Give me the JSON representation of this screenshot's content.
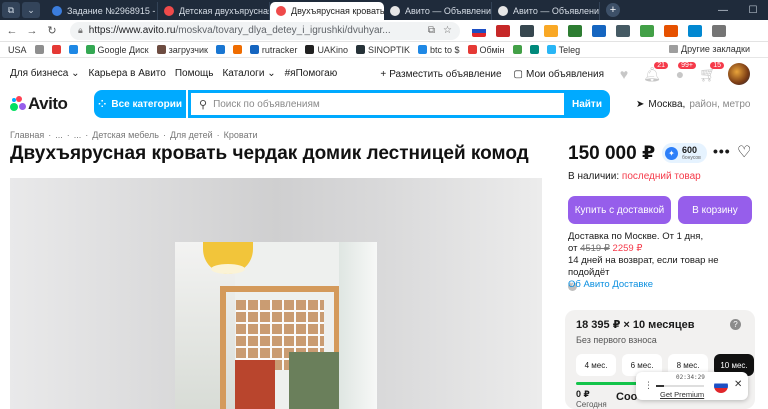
{
  "browser": {
    "tabs": [
      {
        "title": "Задание №2968915 - прос",
        "color": "#3b7ddd",
        "active": false
      },
      {
        "title": "Детская двухъярусная кр",
        "color": "#ef4a4a",
        "active": false
      },
      {
        "title": "Двухъярусная кровать",
        "color": "#ef4a4a",
        "active": true
      },
      {
        "title": "Авито — Объявления на",
        "color": "#2a2a2a",
        "active": false
      },
      {
        "title": "Авито — Объявления на",
        "color": "#2a2a2a",
        "active": false
      }
    ],
    "url_domain": "https://www.avito.ru",
    "url_path": "/moskva/tovary_dlya_detey_i_igrushki/dvuhyar...",
    "bookmarks": [
      "USA",
      "",
      "",
      "",
      "Google Диск",
      "загрузчик",
      "",
      "",
      "rutracker",
      "UAKino",
      "SINOPTIK",
      "btc to $",
      "Обмін",
      "",
      "",
      "",
      "Teleg"
    ],
    "bookmarks_other": "Другие закладки"
  },
  "topnav": {
    "links": [
      "Для бизнеса",
      "Карьера в Авито",
      "Помощь",
      "Каталоги",
      "#яПомогаю"
    ],
    "post_ad": "Разместить объявление",
    "my_ads": "Мои объявления",
    "badges": {
      "notifications": "21",
      "messages": "99+",
      "cart": "15"
    }
  },
  "search": {
    "logo": "Avito",
    "categories": "Все категории",
    "placeholder": "Поиск по объявлениям",
    "find": "Найти",
    "location": "Москва,",
    "location_hint": "район, метро"
  },
  "breadcrumbs": [
    "Главная",
    "·",
    "...",
    "·",
    "...",
    "·",
    "Детская мебель",
    "·",
    "Для детей",
    "·",
    "Кровати"
  ],
  "listing": {
    "title": "Двухъярусная кровать чердак домик лестницей комод",
    "price": "150 000 ₽",
    "bonus_value": "600",
    "bonus_label": "бонусов",
    "stock_label": "В наличии:",
    "stock_last": "последний товар",
    "buy_delivery": "Купить с доставкой",
    "to_cart": "В корзину",
    "delivery_line1": "Доставка по Москве. От 1 дня,",
    "delivery_from": "от",
    "delivery_old": "4519 ₽",
    "delivery_new": "2259 ₽",
    "return_line": "14 дней на возврат, если товар не подойдёт",
    "about_delivery": "Об Авито Доставке"
  },
  "credit": {
    "amount": "18 395 ₽ × 10 месяцев",
    "sub": "Без первого взноса",
    "terms": [
      "4 мес.",
      "6 мес.",
      "8 мес.",
      "10 мес."
    ],
    "selected_term": 3,
    "progress": 0.5,
    "zero": "0 ₽",
    "today": "Сегодня",
    "soo": "Соо"
  },
  "vpn": {
    "timer": "02:34:29",
    "premium": "Get Premium"
  }
}
